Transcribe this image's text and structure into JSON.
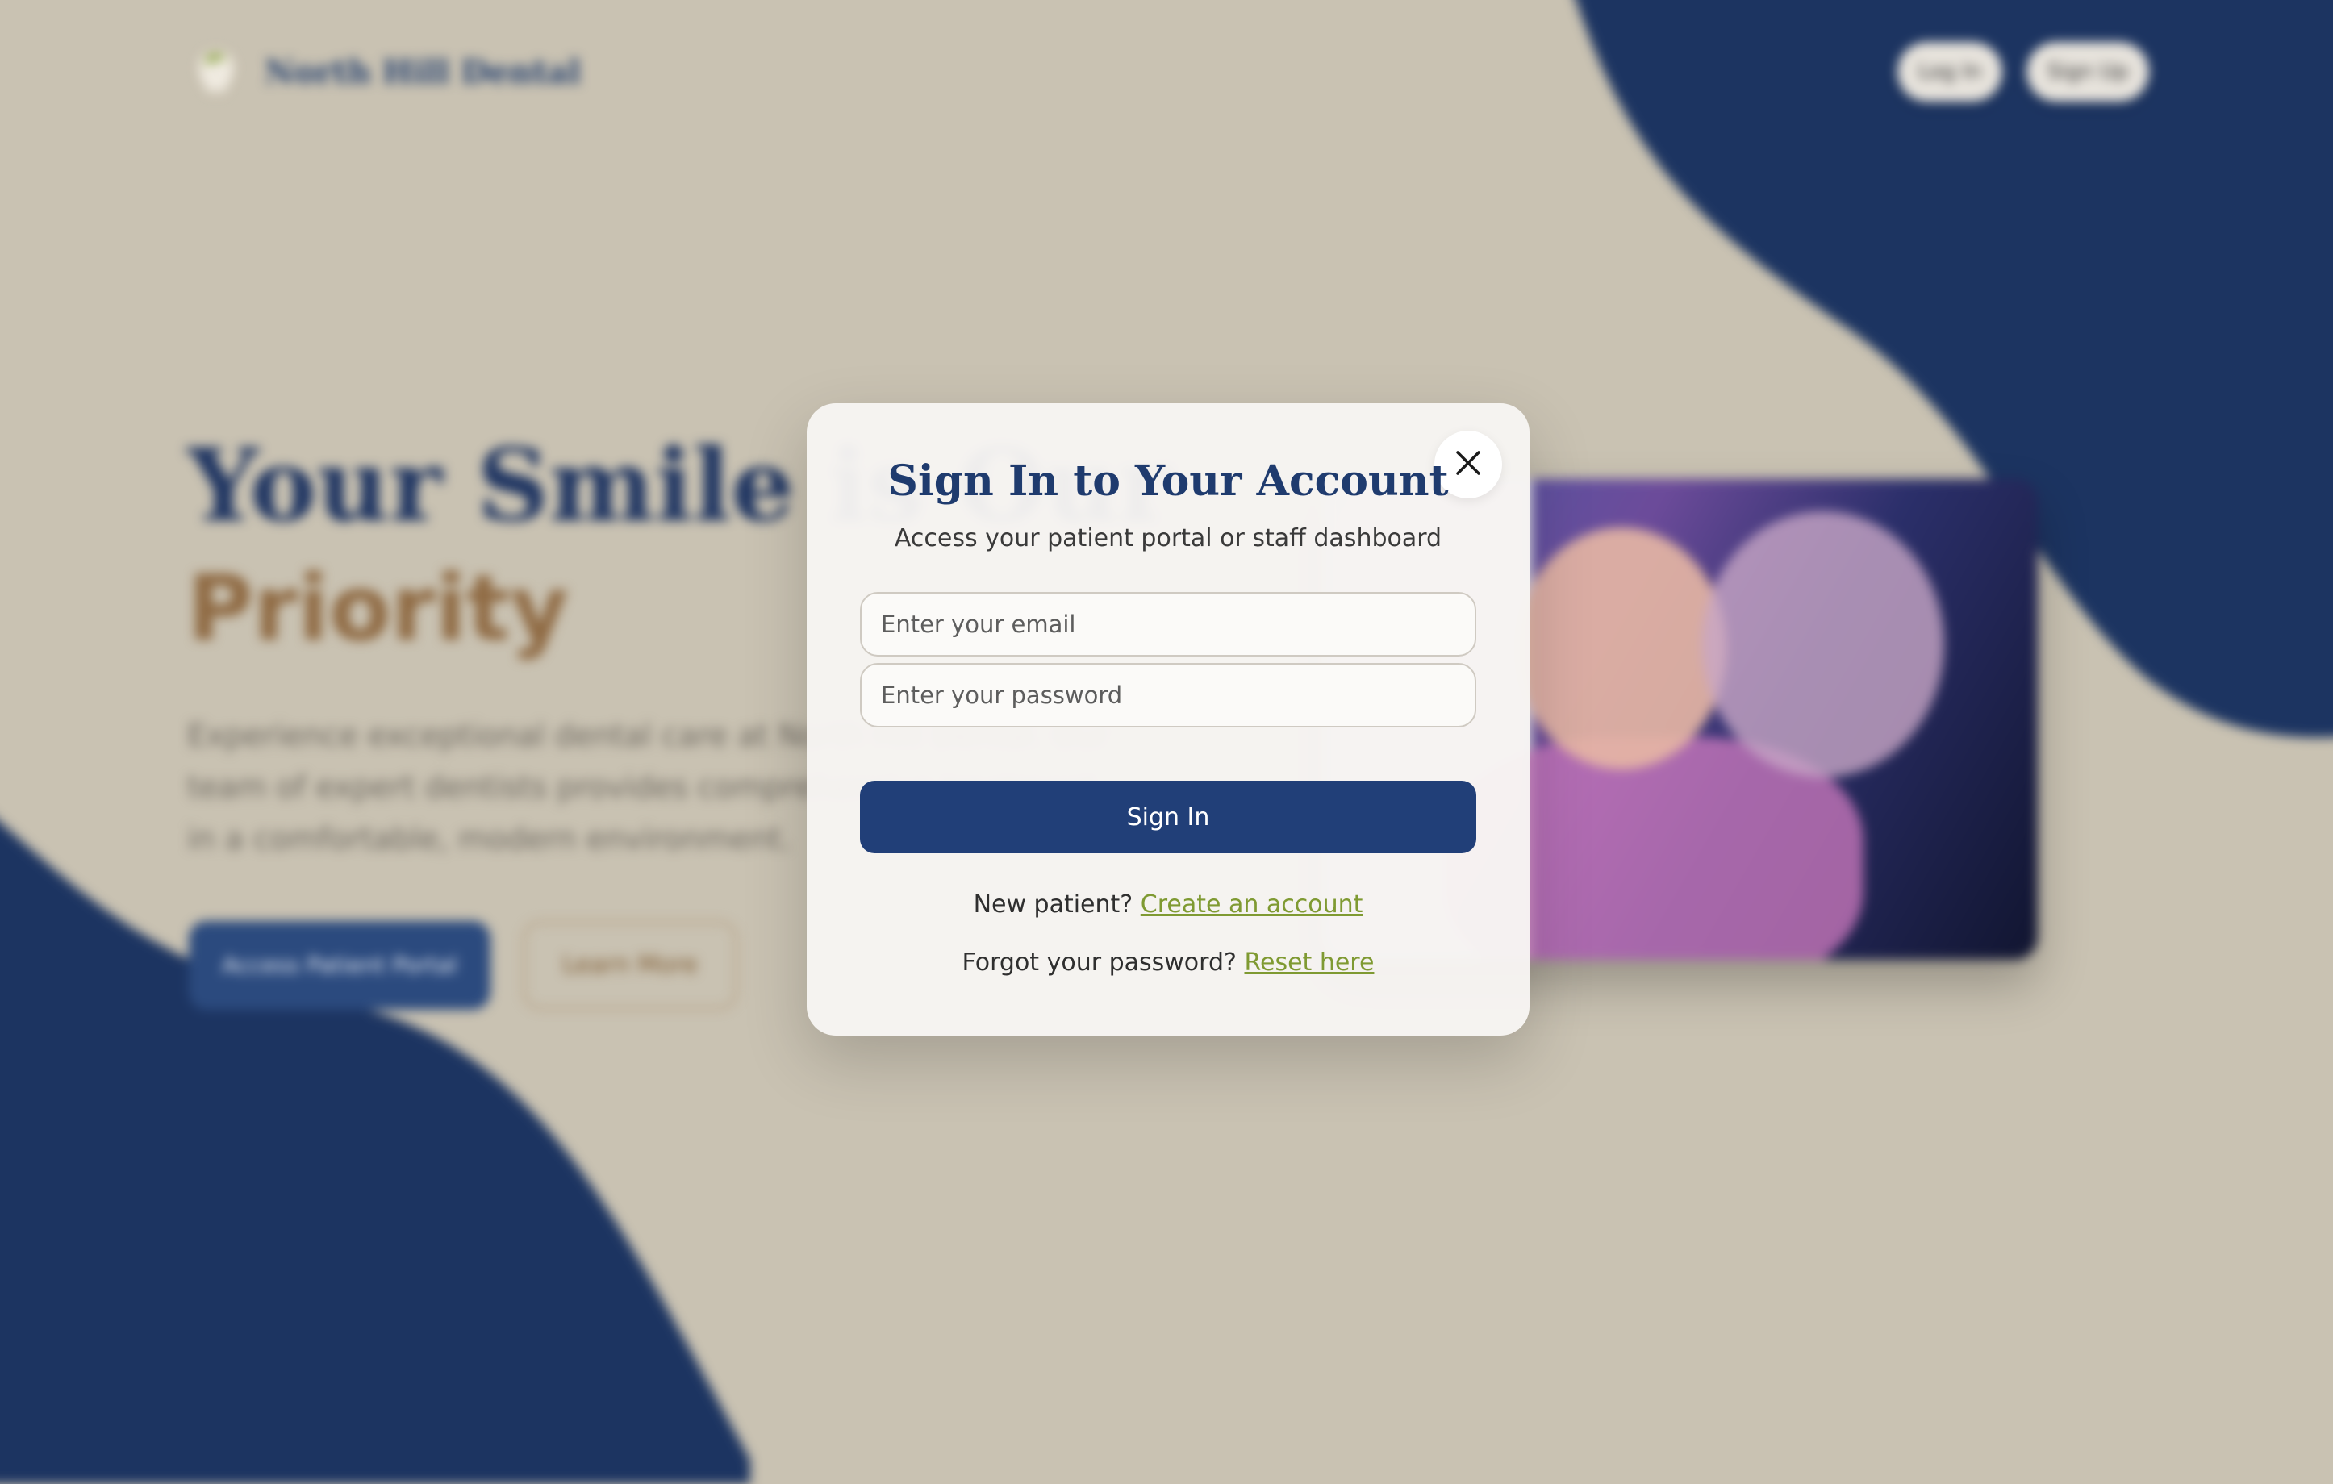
{
  "header": {
    "brand_name": "North Hill Dental",
    "login_label": "Log In",
    "signup_label": "Sign Up"
  },
  "hero": {
    "title_line1": "Your Smile is Our",
    "title_line2": "Priority",
    "description": "Experience exceptional dental care at North Hill Dental. Our team of expert dentists provides comprehensive treatment in a comfortable, modern environment.",
    "primary_cta": "Access Patient Portal",
    "secondary_cta": "Learn More"
  },
  "modal": {
    "title": "Sign In to Your Account",
    "subtitle": "Access your patient portal or staff dashboard",
    "email_placeholder": "Enter your email",
    "password_placeholder": "Enter your password",
    "submit_label": "Sign In",
    "new_patient_text": "New patient?",
    "create_account_link": "Create an account",
    "forgot_text": "Forgot your password?",
    "reset_link": "Reset here"
  },
  "icons": {
    "close": "close-icon",
    "logo": "tooth-leaf-logo-icon"
  },
  "colors": {
    "background": "#c9c2b2",
    "navy": "#1c3461",
    "primary_button": "#213f78",
    "link": "#7f9a32",
    "accent_brown": "#8f6a43"
  }
}
